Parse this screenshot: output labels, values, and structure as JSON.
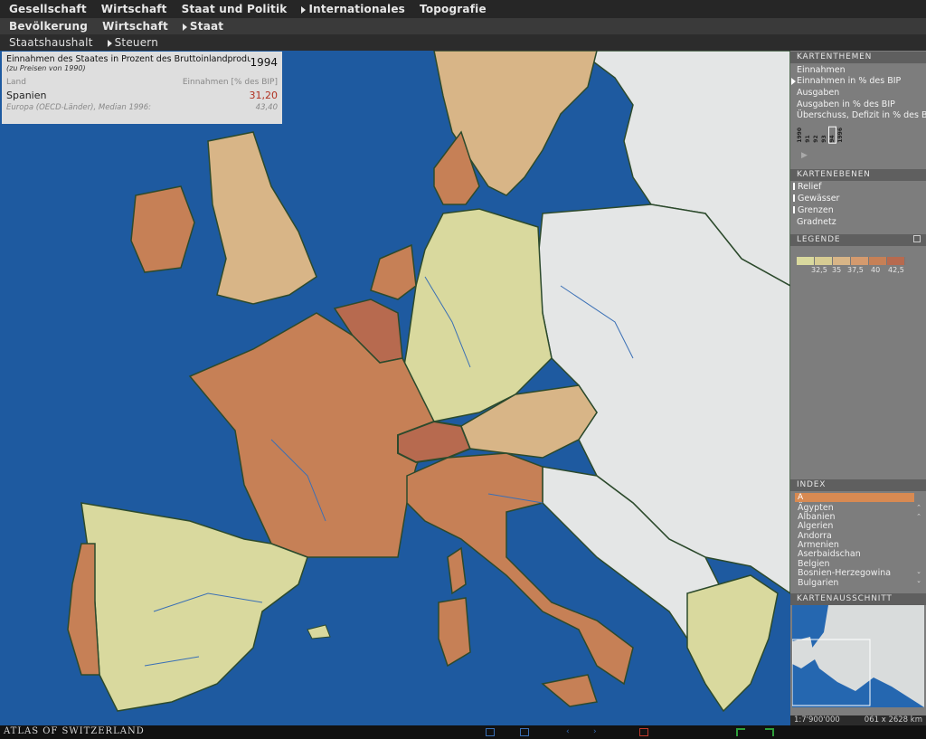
{
  "nav": {
    "top": [
      "Gesellschaft",
      "Wirtschaft",
      "Staat und Politik",
      "Internationales",
      "Topografie"
    ],
    "second": [
      "Bevölkerung",
      "Wirtschaft",
      "Staat"
    ],
    "third": [
      "Staatshaushalt",
      "Steuern"
    ]
  },
  "info": {
    "title": "Einnahmen des Staates in Prozent des Bruttoinlandproduktes,",
    "year": "1994",
    "subtitle": "(zu Preisen von 1990)",
    "col_land": "Land",
    "col_value": "Einnahmen [% des BIP]",
    "country": "Spanien",
    "value": "31,20",
    "footer_label": "Europa (OECD-Länder), Median 1996:",
    "footer_value": "43,40"
  },
  "panel": {
    "themes_header": "KARTENTHEMEN",
    "themes": [
      "Einnahmen",
      "Einnahmen in % des BIP",
      "Ausgaben",
      "Ausgaben in % des BIP",
      "Überschuss, Defizit in % des BIP"
    ],
    "active_theme_index": 1,
    "years": [
      "1990",
      "91",
      "92",
      "93",
      "94",
      "1996"
    ],
    "selected_year": "94",
    "layers_header": "KARTENEBENEN",
    "layers": [
      "Relief",
      "Gewässer",
      "Grenzen",
      "Gradnetz"
    ],
    "layers_checked": [
      true,
      true,
      true,
      false
    ],
    "legend_header": "LEGENDE",
    "legend_colors": [
      "#d9d99e",
      "#d7cc93",
      "#d8b587",
      "#d49a6e",
      "#c68056",
      "#b76a4f"
    ],
    "legend_labels": [
      "32,5",
      "35",
      "37,5",
      "40",
      "42,5"
    ],
    "index_header": "INDEX",
    "index_selected": "A",
    "index_items": [
      "Ägypten",
      "Albanien",
      "Algerien",
      "Andorra",
      "Armenien",
      "Aserbaidschan",
      "Belgien",
      "Bosnien-Herzegowina",
      "Bulgarien"
    ],
    "overview_header": "KARTENAUSSCHNITT",
    "scale": "1:7'900'000",
    "extent": "061 x 2628 km"
  },
  "footer": {
    "logo": "ATLAS OF SWITZERLAND"
  },
  "colors": {
    "sea": "#1e5aa0",
    "no_data": "#e4e6e6",
    "high": "#b76a4f",
    "mid": "#c68056",
    "low": "#d9d99e"
  }
}
